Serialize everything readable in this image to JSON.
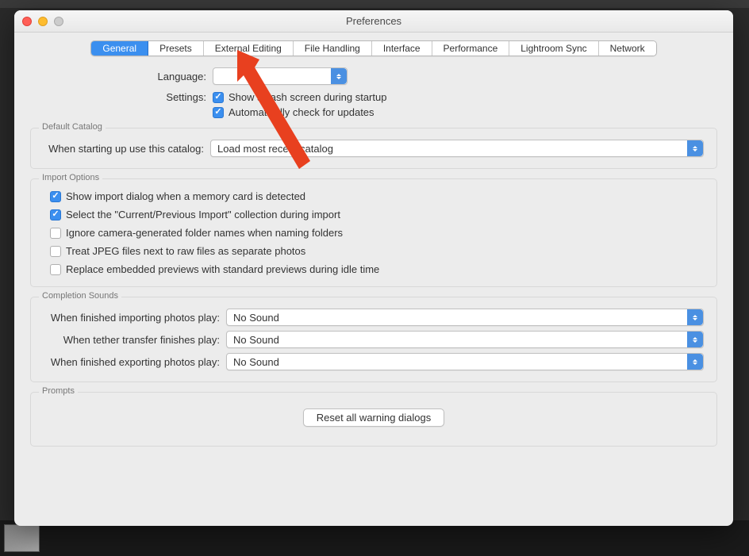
{
  "window": {
    "title": "Preferences"
  },
  "tabs": {
    "general": "General",
    "presets": "Presets",
    "external_editing": "External Editing",
    "file_handling": "File Handling",
    "interface": "Interface",
    "performance": "Performance",
    "lightroom_sync": "Lightroom Sync",
    "network": "Network"
  },
  "general": {
    "language_label": "Language:",
    "language_value": "",
    "settings_label": "Settings:",
    "show_splash": "Show splash screen during startup",
    "auto_updates": "Automatically check for updates"
  },
  "default_catalog": {
    "legend": "Default Catalog",
    "label": "When starting up use this catalog:",
    "value": "Load most recent catalog"
  },
  "import_options": {
    "legend": "Import Options",
    "opt1": "Show import dialog when a memory card is detected",
    "opt2": "Select the \"Current/Previous Import\" collection during import",
    "opt3": "Ignore camera-generated folder names when naming folders",
    "opt4": "Treat JPEG files next to raw files as separate photos",
    "opt5": "Replace embedded previews with standard previews during idle time"
  },
  "completion_sounds": {
    "legend": "Completion Sounds",
    "import_label": "When finished importing photos play:",
    "tether_label": "When tether transfer finishes play:",
    "export_label": "When finished exporting photos play:",
    "no_sound": "No Sound"
  },
  "prompts": {
    "legend": "Prompts",
    "reset_button": "Reset all warning dialogs"
  }
}
